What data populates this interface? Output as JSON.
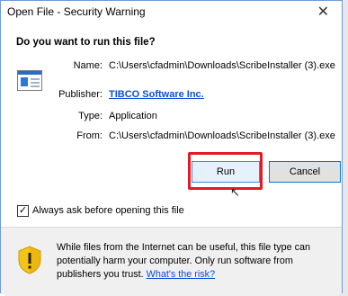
{
  "window": {
    "title": "Open File - Security Warning",
    "close_glyph": "✕"
  },
  "dialog": {
    "question": "Do you want to run this file?",
    "icon": "application-file-icon",
    "fields": {
      "name_label": "Name:",
      "name_value": "C:\\Users\\cfadmin\\Downloads\\ScribeInstaller (3).exe",
      "publisher_label": "Publisher:",
      "publisher_value": "TIBCO Software Inc.",
      "type_label": "Type:",
      "type_value": "Application",
      "from_label": "From:",
      "from_value": "C:\\Users\\cfadmin\\Downloads\\ScribeInstaller (3).exe"
    },
    "buttons": {
      "run_label": "Run",
      "cancel_label": "Cancel"
    },
    "checkbox": {
      "label": "Always ask before opening this file",
      "checked": true,
      "check_glyph": "✓"
    },
    "warning": {
      "text": "While files from the Internet can be useful, this file type can potentially harm your computer. Only run software from publishers you trust.",
      "link_text": "What's the risk?"
    }
  },
  "colors": {
    "link": "#0b4fd8",
    "highlight": "#e41b23",
    "button_focus_border": "#0078d7"
  }
}
